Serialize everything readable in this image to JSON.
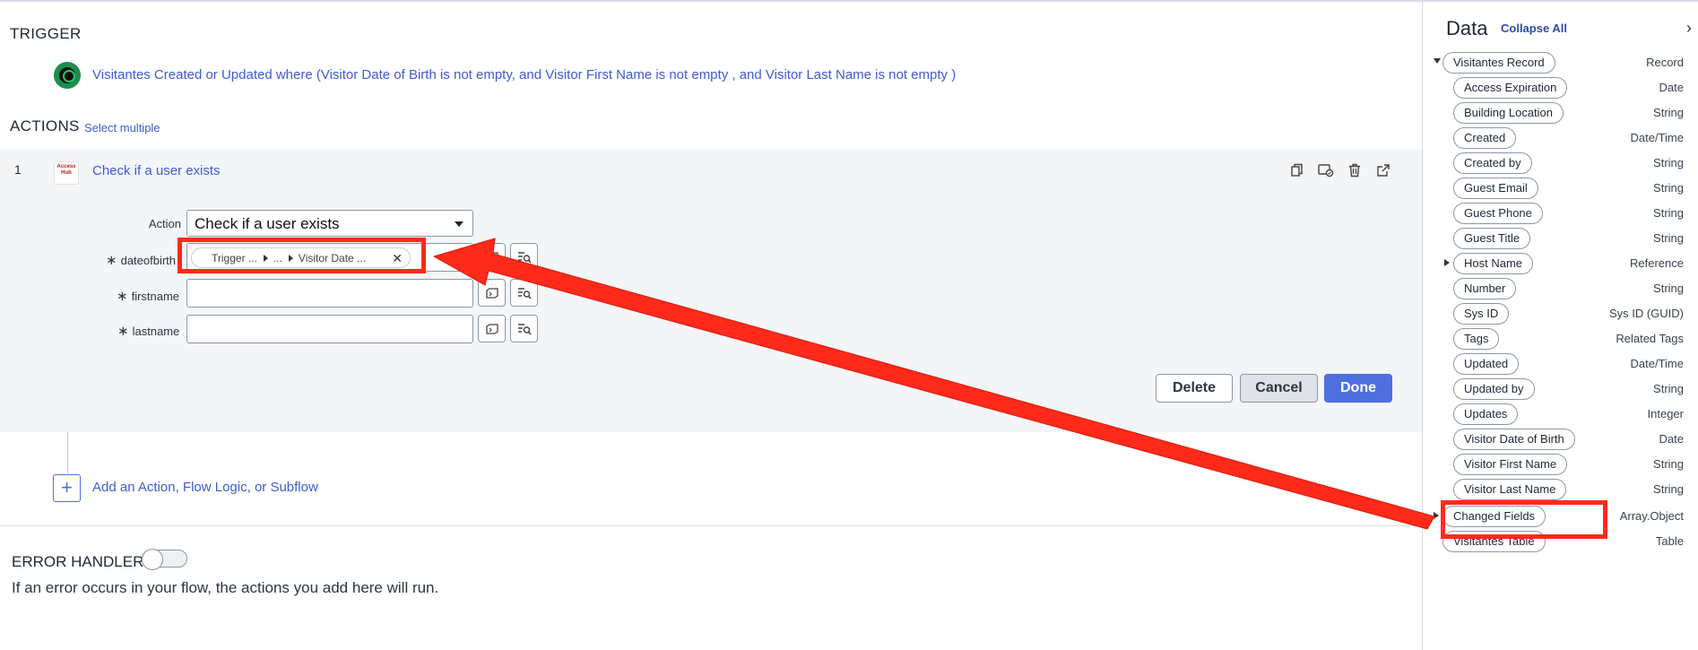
{
  "trigger": {
    "heading": "TRIGGER",
    "description": "Visitantes Created or Updated where (Visitor Date of Birth is not empty, and Visitor First Name is not empty , and Visitor Last Name is not empty )"
  },
  "actions": {
    "heading": "ACTIONS",
    "select_multiple": "Select multiple",
    "step_number": "1",
    "app_logo_text": "Access Hub",
    "step_title": "Check if a user exists",
    "form": {
      "action_label": "Action",
      "action_value": "Check if a user exists",
      "dateofbirth_label": "dateofbirth",
      "firstname_label": "firstname",
      "lastname_label": "lastname",
      "required_marker": "∗",
      "dob_pill": {
        "segment1": "Trigger ...",
        "segment2": "...",
        "segment3": "Visitor Date ..."
      }
    },
    "buttons": {
      "delete": "Delete",
      "cancel": "Cancel",
      "done": "Done"
    },
    "add_label": "Add an Action, Flow Logic, or Subflow"
  },
  "error_handler": {
    "heading": "ERROR HANDLER",
    "toggle_on": false,
    "description": "If an error occurs in your flow, the actions you add here will run."
  },
  "data_panel": {
    "title": "Data",
    "collapse_all": "Collapse All",
    "items": [
      {
        "label": "Visitantes Record",
        "type": "Record",
        "expander": "down"
      },
      {
        "label": "Access Expiration",
        "type": "Date"
      },
      {
        "label": "Building Location",
        "type": "String"
      },
      {
        "label": "Created",
        "type": "Date/Time"
      },
      {
        "label": "Created by",
        "type": "String"
      },
      {
        "label": "Guest Email",
        "type": "String"
      },
      {
        "label": "Guest Phone",
        "type": "String"
      },
      {
        "label": "Guest Title",
        "type": "String"
      },
      {
        "label": "Host Name",
        "type": "Reference",
        "expander": "right"
      },
      {
        "label": "Number",
        "type": "String"
      },
      {
        "label": "Sys ID",
        "type": "Sys ID (GUID)"
      },
      {
        "label": "Tags",
        "type": "Related Tags"
      },
      {
        "label": "Updated",
        "type": "Date/Time"
      },
      {
        "label": "Updated by",
        "type": "String"
      },
      {
        "label": "Updates",
        "type": "Integer"
      },
      {
        "label": "Visitor Date of Birth",
        "type": "Date",
        "highlighted": true
      },
      {
        "label": "Visitor First Name",
        "type": "String"
      },
      {
        "label": "Visitor Last Name",
        "type": "String"
      },
      {
        "label": "Changed Fields",
        "type": "Array.Object",
        "expander": "right"
      },
      {
        "label": "Visitantes Table",
        "type": "Table"
      }
    ]
  },
  "colors": {
    "link": "#3f5ccf",
    "primary_button": "#4f6fe0",
    "annotation": "#ff2a1a",
    "trigger_icon": "#1a8f4d"
  }
}
